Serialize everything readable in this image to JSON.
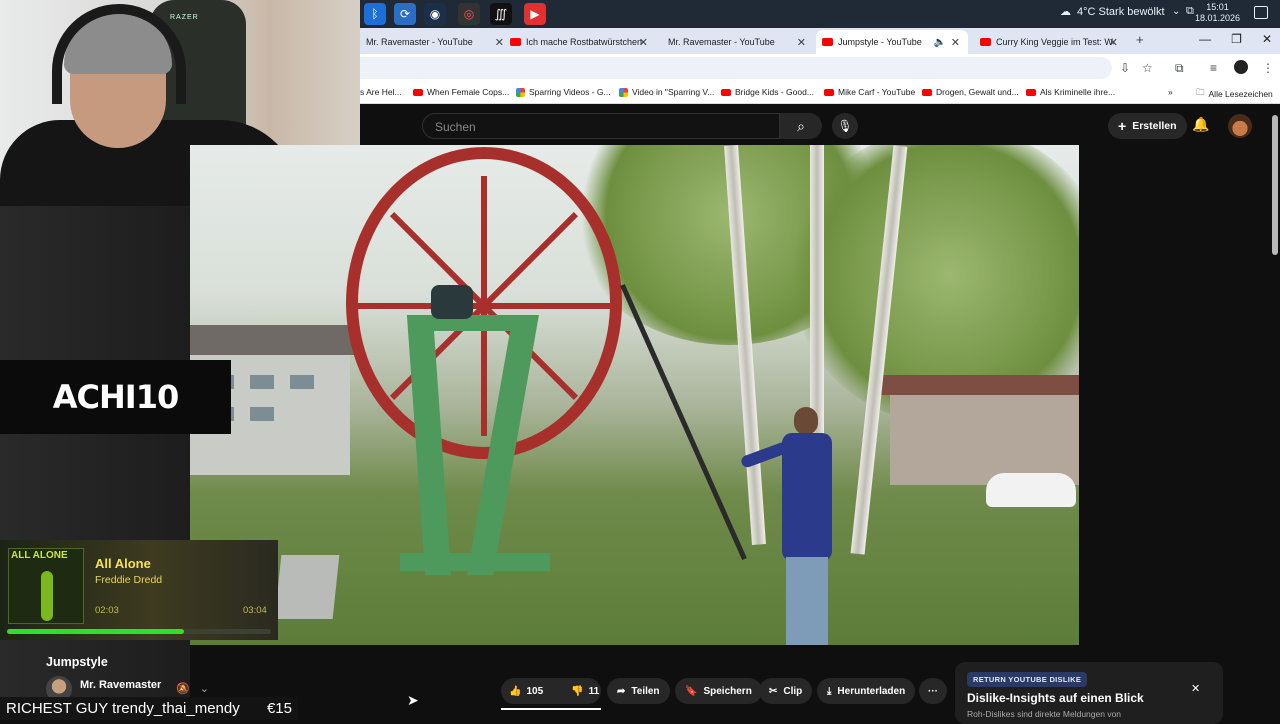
{
  "taskbar": {
    "weather": "4°C  Stark bewölkt",
    "weather_badge": "1",
    "time": "15:01",
    "date": "18.01.2026"
  },
  "browser": {
    "tabs": [
      {
        "label": "Mr. Ravemaster - YouTube",
        "active": false
      },
      {
        "label": "Ich mache Rostbatwürstchen m",
        "active": false
      },
      {
        "label": "Mr. Ravemaster - YouTube",
        "active": false
      },
      {
        "label": "Jumpstyle - YouTube",
        "active": true
      },
      {
        "label": "Curry King Veggie im Test: Wel",
        "active": false
      }
    ],
    "bookmarks": [
      "s Are Hel...",
      "When Female Cops...",
      "Sparring Videos - G...",
      "Video in \"Sparring V...",
      "Bridge Kids - Good...",
      "Mike Carf - YouTube",
      "Drogen, Gewalt und...",
      "Als Kriminelle ihre..."
    ],
    "all_bookmarks": "Alle Lesezeichen"
  },
  "youtube": {
    "search_placeholder": "Suchen",
    "create_label": "Erstellen",
    "video_title": "Jumpstyle",
    "channel": "Mr. Ravemaster",
    "likes": "105",
    "dislikes": "11",
    "share_label": "Teilen",
    "save_label": "Speichern",
    "clip_label": "Clip",
    "download_label": "Herunterladen"
  },
  "dislike_panel": {
    "badge": "RETURN YOUTUBE DISLIKE",
    "heading": "Dislike-Insights auf einen Blick",
    "subtext": "Roh-Dislikes sind direkte Meldungen von"
  },
  "stream_overlay": {
    "chair_brand": "RAZER",
    "brand_logo": "ACHI10",
    "song_title": "All Alone",
    "song_artist": "Freddie Dredd",
    "cover_text": "ALL ALONE",
    "time_current": "02:03",
    "time_total": "03:04",
    "progress": 0.67,
    "ticker_left": "RICHEST GUY trendy_thai_mendy",
    "ticker_right": "€15"
  },
  "colors": {
    "youtube_red": "#ff0000",
    "player_green": "#2ee02e",
    "song_yellow": "#f3e257"
  }
}
